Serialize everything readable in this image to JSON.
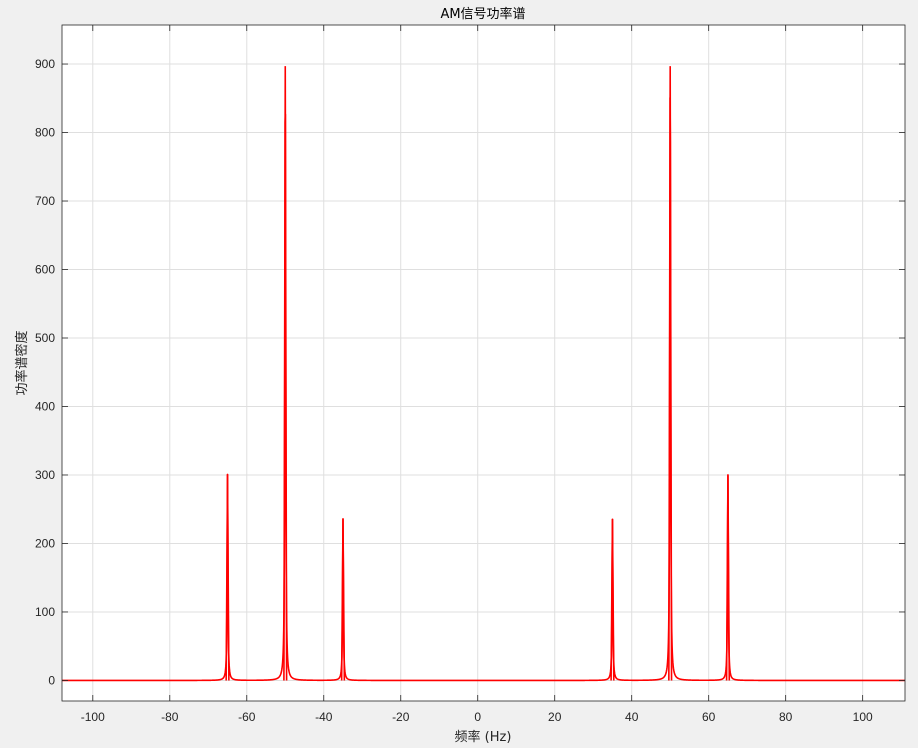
{
  "chart_data": {
    "type": "line",
    "title": "AM信号功率谱",
    "xlabel": "频率 (Hz)",
    "ylabel": "功率谱密度",
    "xlim": [
      -108,
      111
    ],
    "ylim": [
      -30,
      957
    ],
    "xticks": [
      -100,
      -80,
      -60,
      -40,
      -20,
      0,
      20,
      40,
      60,
      80,
      100
    ],
    "yticks": [
      0,
      100,
      200,
      300,
      400,
      500,
      600,
      700,
      800,
      900
    ],
    "grid": true,
    "series": [
      {
        "color": "#ff0000",
        "baseline": 0,
        "peaks": [
          {
            "x": -65,
            "y": 301
          },
          {
            "x": -50,
            "y": 897
          },
          {
            "x": -35,
            "y": 236
          },
          {
            "x": 35,
            "y": 236
          },
          {
            "x": 50,
            "y": 897
          },
          {
            "x": 65,
            "y": 301
          }
        ]
      }
    ]
  }
}
